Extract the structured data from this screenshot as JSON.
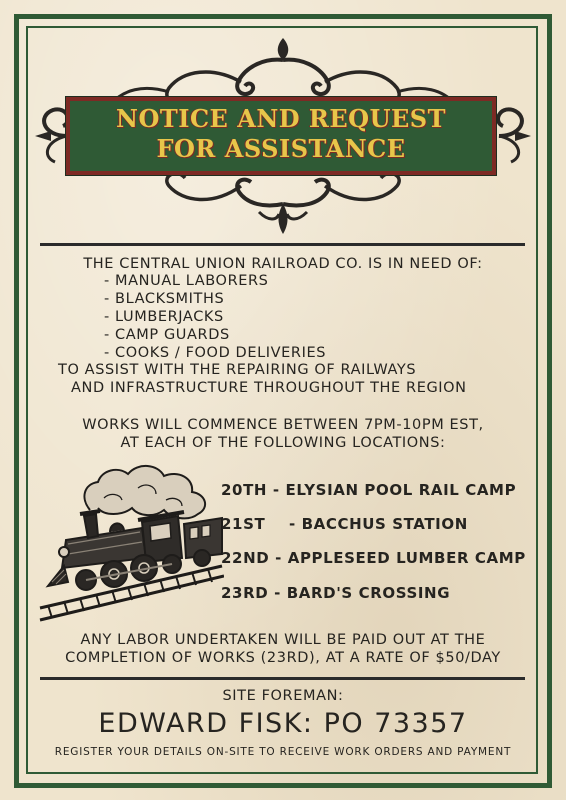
{
  "banner": {
    "title_line1": "NOTICE AND REQUEST",
    "title_line2": "FOR ASSISTANCE"
  },
  "intro": {
    "heading": "THE CENTRAL UNION RAILROAD CO. IS IN NEED OF:",
    "roles": [
      "- MANUAL LABORERS",
      "- BLACKSMITHS",
      "- LUMBERJACKS",
      "- CAMP GUARDS",
      "- COOKS / FOOD DELIVERIES"
    ],
    "purpose_line1": "TO ASSIST WITH THE REPAIRING OF RAILWAYS",
    "purpose_line2": "AND INFRASTRUCTURE THROUGHOUT THE REGION"
  },
  "schedule": {
    "line1": "WORKS WILL COMMENCE BETWEEN 7PM-10PM EST,",
    "line2": "AT EACH OF THE FOLLOWING LOCATIONS:",
    "locations": [
      {
        "date": "20TH",
        "place": "- ELYSIAN POOL RAIL CAMP"
      },
      {
        "date": "21ST",
        "place": "- BACCHUS STATION"
      },
      {
        "date": "22ND",
        "place": "- APPLESEED LUMBER CAMP"
      },
      {
        "date": "23RD",
        "place": "- BARD'S CROSSING"
      }
    ]
  },
  "payment": {
    "line1": "ANY LABOR UNDERTAKEN WILL BE PAID OUT AT THE",
    "line2": "COMPLETION OF WORKS (23RD), AT A RATE OF $50/DAY"
  },
  "footer": {
    "label": "SITE FOREMAN:",
    "name": "EDWARD FISK: PO 73357",
    "note": "REGISTER YOUR DETAILS ON-SITE  TO RECEIVE WORK ORDERS AND PAYMENT"
  },
  "colors": {
    "paper": "#efe4cd",
    "frame_green": "#2f5a35",
    "banner_gold": "#e7c64a",
    "banner_red": "#7d2a24"
  },
  "icons": [
    "ornamental-scroll",
    "steam-locomotive-illustration"
  ]
}
